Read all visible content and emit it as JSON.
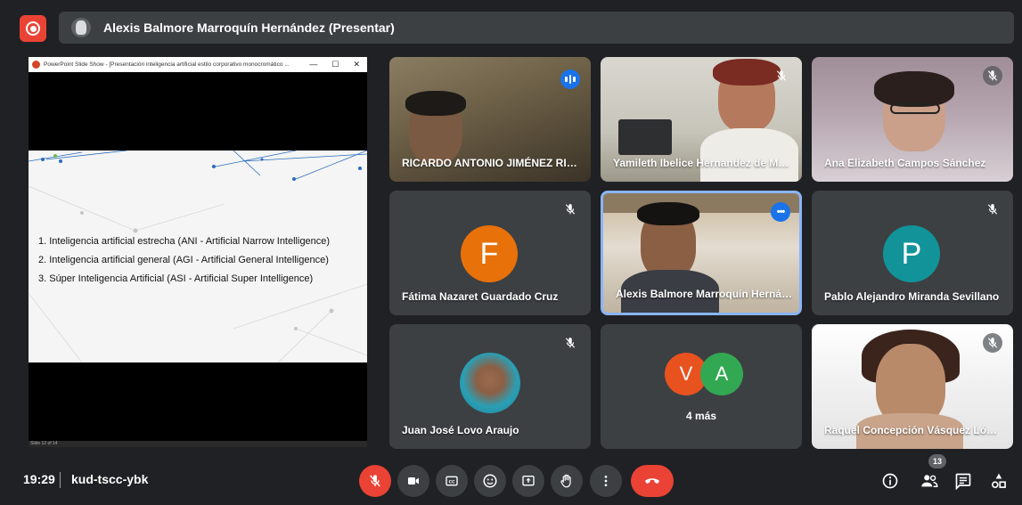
{
  "top_bar": {
    "presenter_label": "Alexis Balmore Marroquín Hernández (Presentar)"
  },
  "slide_window": {
    "title": "PowerPoint Slide Show - [Presentación inteligencia artificial estilo corporativo monocromático ...",
    "items": [
      "1. Inteligencia artificial estrecha (ANI - Artificial Narrow Intelligence)",
      "2. Inteligencia artificial general (AGI - Artificial General Intelligence)",
      "3. Súper Inteligencia Artificial (ASI - Artificial Super Intelligence)"
    ],
    "status": "Slide 12 of 14"
  },
  "participants": [
    {
      "name": "RICARDO ANTONIO JIMÉNEZ RIVAS",
      "state": "speaking"
    },
    {
      "name": "Yamileth Ibelice Hernandez de Ma...",
      "state": "muted"
    },
    {
      "name": "Ana Elizabeth Campos Sánchez",
      "state": "muted"
    },
    {
      "name": "Fátima Nazaret Guardado Cruz",
      "initial": "F",
      "color": "#e8710a",
      "state": "muted"
    },
    {
      "name": "Alexis Balmore Marroquín Hernán...",
      "state": "pinned"
    },
    {
      "name": "Pablo Alejandro Miranda Sevillano",
      "initial": "P",
      "color": "#12939a",
      "state": "muted"
    },
    {
      "name": "Juan José Lovo Araujo",
      "state": "muted"
    },
    {
      "name": "4 más",
      "initials": [
        "V",
        "A"
      ],
      "colors": [
        "#e8521f",
        "#33a852"
      ]
    },
    {
      "name": "Raquel Concepción Vásquez López",
      "state": "muted"
    }
  ],
  "bottom_bar": {
    "time": "19:29",
    "meeting_code": "kud-tscc-ybk",
    "participant_count": "13"
  }
}
